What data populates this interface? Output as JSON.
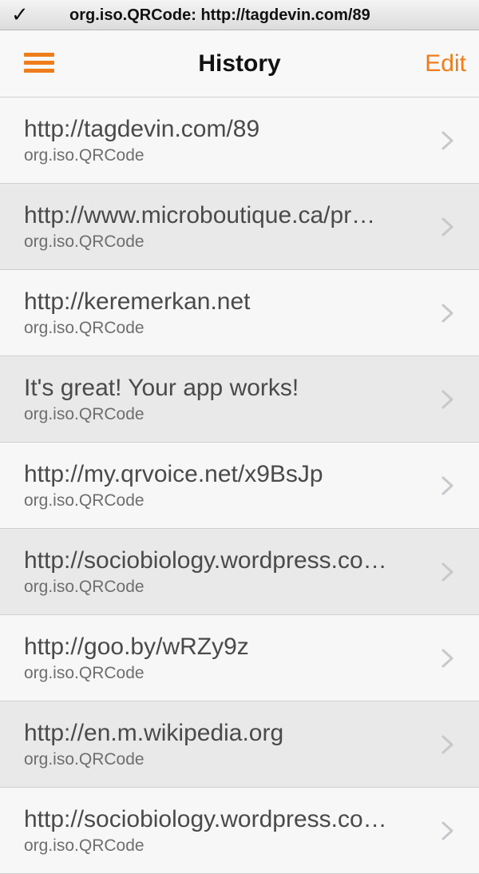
{
  "notification": {
    "check_glyph": "✓",
    "text": "org.iso.QRCode: http://tagdevin.com/89"
  },
  "navbar": {
    "menu_icon": "hamburger-menu-icon",
    "title": "History",
    "edit_label": "Edit"
  },
  "colors": {
    "accent": "#ef7d1b",
    "row_light": "#f7f7f7",
    "row_dark": "#e9e9e9"
  },
  "history": [
    {
      "title": "http://tagdevin.com/89",
      "subtitle": "org.iso.QRCode"
    },
    {
      "title": "http://www.microboutique.ca/pr…",
      "subtitle": "org.iso.QRCode"
    },
    {
      "title": "http://keremerkan.net",
      "subtitle": "org.iso.QRCode"
    },
    {
      "title": "It's great! Your app works!",
      "subtitle": "org.iso.QRCode"
    },
    {
      "title": "http://my.qrvoice.net/x9BsJp",
      "subtitle": "org.iso.QRCode"
    },
    {
      "title": "http://sociobiology.wordpress.co…",
      "subtitle": "org.iso.QRCode"
    },
    {
      "title": "http://goo.by/wRZy9z",
      "subtitle": "org.iso.QRCode"
    },
    {
      "title": "http://en.m.wikipedia.org",
      "subtitle": "org.iso.QRCode"
    },
    {
      "title": "http://sociobiology.wordpress.co…",
      "subtitle": "org.iso.QRCode"
    }
  ]
}
